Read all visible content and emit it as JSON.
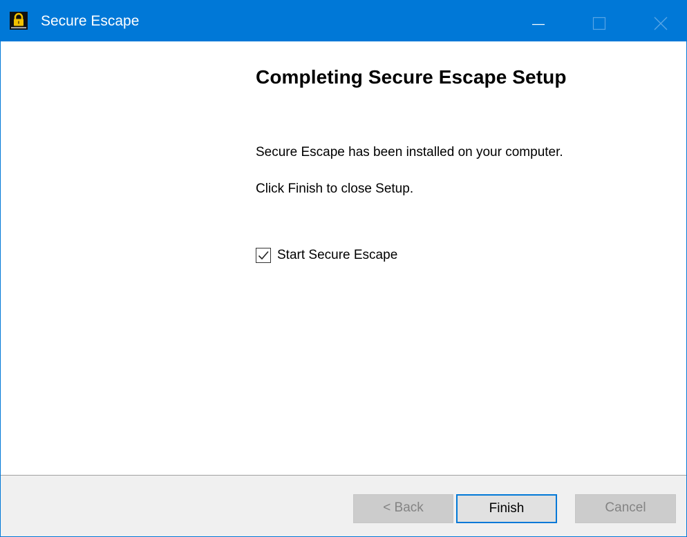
{
  "window": {
    "title": "Secure Escape",
    "icon": "padlock-icon"
  },
  "caption_buttons": {
    "minimize": "minimize-icon",
    "maximize": "maximize-icon",
    "close": "close-icon"
  },
  "main": {
    "heading": "Completing Secure Escape Setup",
    "installed_text": "Secure Escape has been installed on your computer.",
    "finish_text": "Click Finish to close Setup.",
    "start_checkbox": {
      "label": "Start Secure Escape",
      "checked": true
    }
  },
  "footer": {
    "back_label": "< Back",
    "finish_label": "Finish",
    "cancel_label": "Cancel"
  },
  "colors": {
    "accent": "#0078d7",
    "footer_bg": "#f0f0f0",
    "disabled_text": "#838383"
  }
}
